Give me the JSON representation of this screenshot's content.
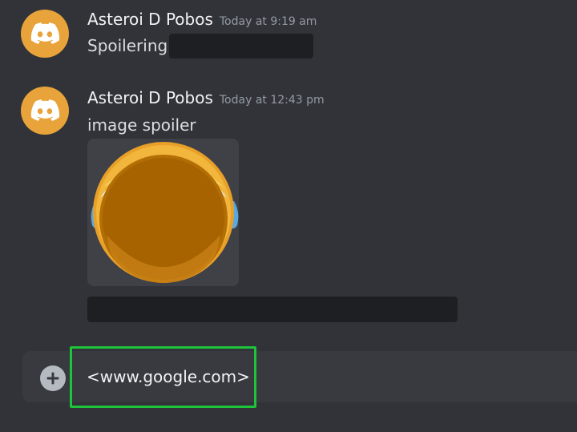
{
  "messages": [
    {
      "author": "Asteroi D Pobos",
      "timestamp": "Today at 9:19 am",
      "text": "Spoilering"
    },
    {
      "author": "Asteroi D Pobos",
      "timestamp": "Today at 12:43 pm",
      "text": "image spoiler"
    }
  ],
  "composer": {
    "value": "<www.google.com>"
  },
  "colors": {
    "background": "#313338",
    "avatar": "#e8a33a",
    "spoiler": "#1e1f22",
    "highlight": "#1ec43a",
    "composer": "#383a40"
  },
  "icons": {
    "avatar": "discord-logo-icon",
    "add": "plus-circle-icon",
    "image": "crying-emoji-image"
  }
}
